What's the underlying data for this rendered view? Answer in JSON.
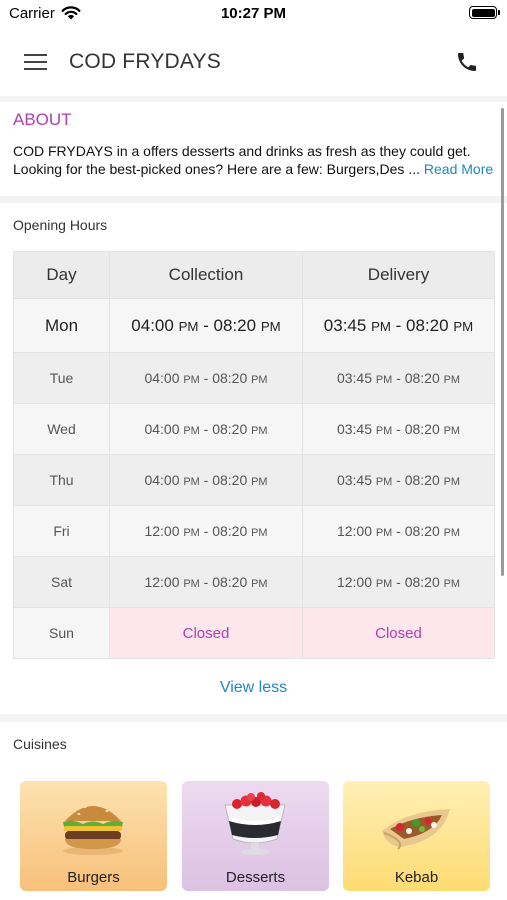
{
  "status_bar": {
    "carrier": "Carrier",
    "time": "10:27 PM"
  },
  "header": {
    "title": "COD FRYDAYS",
    "menu_icon": "hamburger-menu-icon",
    "phone_icon": "phone-icon"
  },
  "about": {
    "title": "ABOUT",
    "line1": "COD FRYDAYS in a offers desserts and drinks as fresh as they could get.",
    "line2": "Looking for the best-picked ones? Here are a few: Burgers,Des ...",
    "read_more": "Read More",
    "title_color": "#b040b0",
    "link_color": "#1e88c7"
  },
  "hours": {
    "title": "Opening Hours",
    "headers": {
      "day": "Day",
      "collection": "Collection",
      "delivery": "Delivery"
    },
    "pm": "PM",
    "closed": "Closed",
    "rows": [
      {
        "day": "Mon",
        "c_start": "04:00",
        "c_end": "08:20",
        "d_start": "03:45",
        "d_end": "08:20"
      },
      {
        "day": "Tue",
        "c_start": "04:00",
        "c_end": "08:20",
        "d_start": "03:45",
        "d_end": "08:20"
      },
      {
        "day": "Wed",
        "c_start": "04:00",
        "c_end": "08:20",
        "d_start": "03:45",
        "d_end": "08:20"
      },
      {
        "day": "Thu",
        "c_start": "04:00",
        "c_end": "08:20",
        "d_start": "03:45",
        "d_end": "08:20"
      },
      {
        "day": "Fri",
        "c_start": "12:00",
        "c_end": "08:20",
        "d_start": "12:00",
        "d_end": "08:20"
      },
      {
        "day": "Sat",
        "c_start": "12:00",
        "c_end": "08:20",
        "d_start": "12:00",
        "d_end": "08:20"
      },
      {
        "day": "Sun"
      }
    ],
    "view_less": "View less",
    "closed_color": "#b040b0"
  },
  "cuisines": {
    "title": "Cuisines",
    "items": [
      {
        "label": "Burgers",
        "icon": "burger-icon"
      },
      {
        "label": "Desserts",
        "icon": "dessert-cup-icon"
      },
      {
        "label": "Kebab",
        "icon": "kebab-wrap-icon"
      }
    ]
  }
}
